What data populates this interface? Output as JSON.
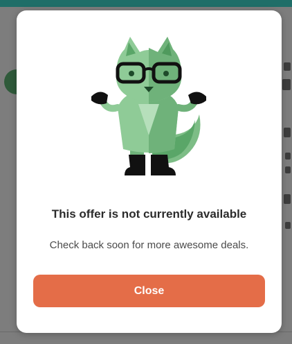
{
  "modal": {
    "title": "This offer is not currently available",
    "message": "Check back soon for more awesome deals.",
    "close_label": "Close",
    "mascot": "fox-with-glasses-shrugging"
  },
  "colors": {
    "backdrop": "#7d7d7d",
    "topbar": "#1f6e68",
    "modal_bg": "#ffffff",
    "button_bg": "#e46d48",
    "button_text": "#ffffff",
    "mascot_light": "#8fcb97",
    "mascot_dark": "#5aa668"
  }
}
